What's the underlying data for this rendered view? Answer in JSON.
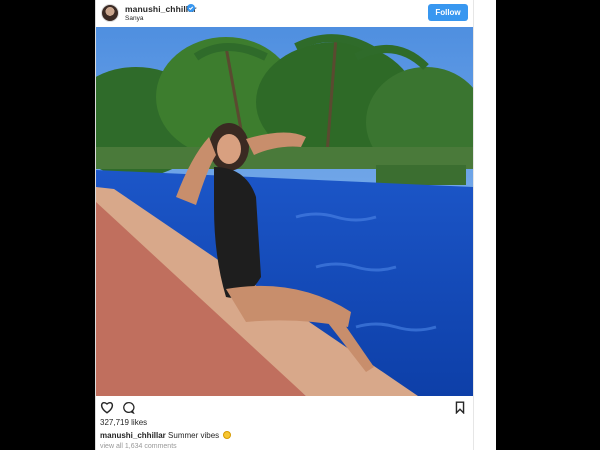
{
  "post": {
    "username": "manushi_chhillar",
    "location": "Sanya",
    "follow_label": "Follow",
    "likes": "327,719 likes",
    "caption_user": "manushi_chhillar",
    "caption_text": "Summer vibes",
    "comments_link": "view all 1,634 comments"
  },
  "icons": {
    "verified": "verified-badge-icon",
    "like": "heart-icon",
    "comment": "comment-bubble-icon",
    "save": "bookmark-icon",
    "emoji": "smiley-emoji-icon"
  },
  "colors": {
    "accent": "#3897f0",
    "text": "#262626",
    "muted": "#999999"
  }
}
